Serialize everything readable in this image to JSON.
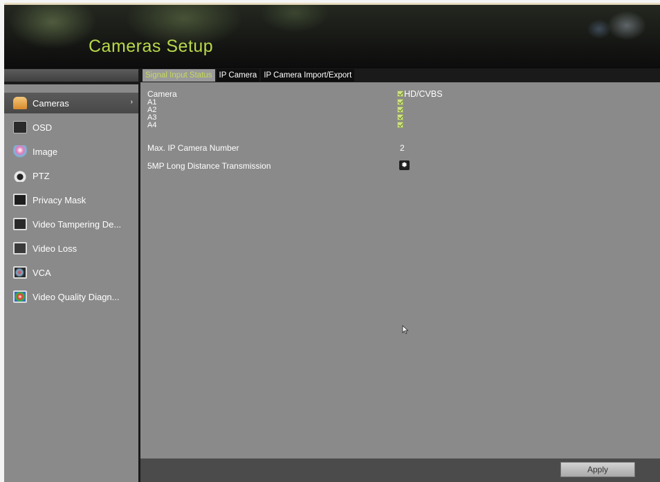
{
  "header": {
    "title": "Cameras Setup"
  },
  "tabs": [
    {
      "label": "Signal Input Status",
      "active": true
    },
    {
      "label": "IP Camera",
      "active": false
    },
    {
      "label": "IP Camera Import/Export",
      "active": false
    }
  ],
  "sidebar": {
    "items": [
      {
        "label": "Cameras",
        "icon": "camera-icon",
        "active": true
      },
      {
        "label": "OSD",
        "icon": "osd-icon"
      },
      {
        "label": "Image",
        "icon": "image-icon"
      },
      {
        "label": "PTZ",
        "icon": "ptz-icon"
      },
      {
        "label": "Privacy Mask",
        "icon": "privacy-mask-icon"
      },
      {
        "label": "Video Tampering De...",
        "icon": "video-tampering-icon"
      },
      {
        "label": "Video Loss",
        "icon": "video-loss-icon"
      },
      {
        "label": "VCA",
        "icon": "vca-icon"
      },
      {
        "label": "Video Quality Diagn...",
        "icon": "video-quality-icon"
      }
    ]
  },
  "signal_input": {
    "column_camera": "Camera",
    "column_type": "HD/CVBS",
    "cameras": [
      {
        "name": "A1",
        "checked": true
      },
      {
        "name": "A2",
        "checked": true
      },
      {
        "name": "A3",
        "checked": true
      },
      {
        "name": "A4",
        "checked": true
      }
    ],
    "max_ip_label": "Max. IP Camera Number",
    "max_ip_value": "2",
    "long_distance_label": "5MP Long Distance Transmission"
  },
  "footer": {
    "apply_label": "Apply"
  },
  "colors": {
    "accent": "#b9d94b",
    "panel": "#8a8a8a",
    "tab_bg": "#0e0e0e"
  }
}
